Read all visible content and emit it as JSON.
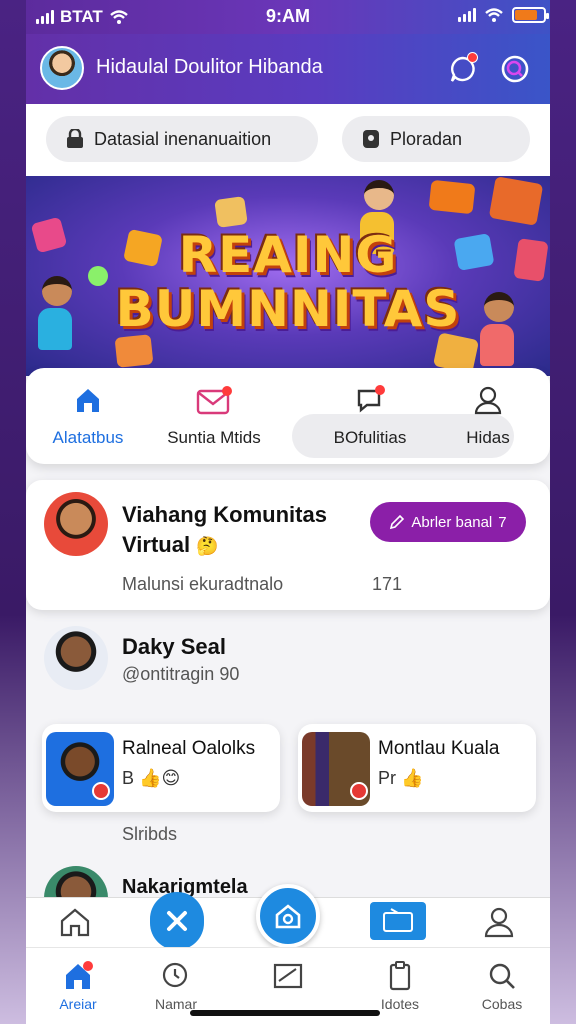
{
  "status_bar": {
    "carrier": "BTAT",
    "time": "9:AM"
  },
  "header": {
    "title": "Hidaulal Doulitor Hibanda"
  },
  "search": {
    "left_pill": "Datasial inenanuaition",
    "right_pill": "Ploradan"
  },
  "banner": {
    "line1": "REAING",
    "line2": "BUMNNITAS"
  },
  "tabs": [
    {
      "label": "Alatatbus"
    },
    {
      "label": "Suntia Mtids"
    },
    {
      "label": "BOfulitias"
    },
    {
      "label": "Hidas"
    }
  ],
  "community": {
    "title_line1": "Viahang Komunitas",
    "title_line2": "Virtual",
    "join_label": "Abrler banal",
    "join_suffix": "7",
    "meta_text": "Malunsi ekuradtnalo",
    "meta_count": "171"
  },
  "profile": {
    "name": "Daky Seal",
    "handle": "@ontitragin 90"
  },
  "mini_cards": [
    {
      "title": "Ralneal Oalolks",
      "sub": "B"
    },
    {
      "title": "Montlau Kuala",
      "sub": "Pr"
    }
  ],
  "section_label": "Slribds",
  "partial_title": "Nakarigmtela",
  "bottom_nav": [
    {
      "label": "Areiar"
    },
    {
      "label": "Namar"
    },
    {
      "label": ""
    },
    {
      "label": "Idotes"
    },
    {
      "label": "Cobas"
    }
  ],
  "colors": {
    "accent_purple": "#8b1fa8",
    "header_start": "#6330a8",
    "header_end": "#3a55c8",
    "active_blue": "#1e6fe0",
    "notif_red": "#ff3b3b"
  }
}
